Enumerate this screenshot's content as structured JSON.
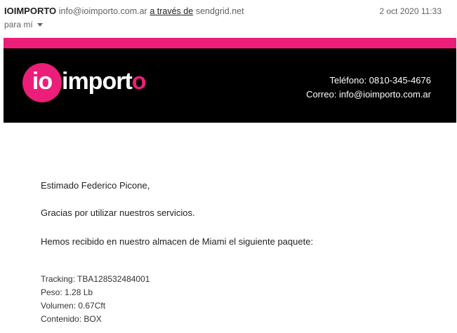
{
  "header": {
    "sender_name": "IOIMPORTO",
    "sender_email": "info@ioimporto.com.ar",
    "via_label": "a través de",
    "via_domain": "sendgrid.net",
    "timestamp": "2 oct 2020 11:33",
    "recipient": "para mí"
  },
  "banner": {
    "logo_io": "io",
    "logo_word_main": "import",
    "logo_word_end": "o",
    "phone": "Teléfono: 0810-345-4676",
    "email": "Correo: info@ioimporto.com.ar",
    "colors": {
      "stripe": "#ec1e79",
      "background": "#000000",
      "brand": "#ec1e79"
    }
  },
  "body": {
    "greeting": "Estimado Federico Picone,",
    "thanks": "Gracias por utilizar nuestros servicios.",
    "intro": "Hemos recibido en nuestro almacen de Miami el siguiente paquete:",
    "tracking": "Tracking: TBA128532484001",
    "weight": "Peso: 1.28 Lb",
    "volume": "Volumen: 0.67Cft",
    "contents": "Contenido: BOX"
  }
}
